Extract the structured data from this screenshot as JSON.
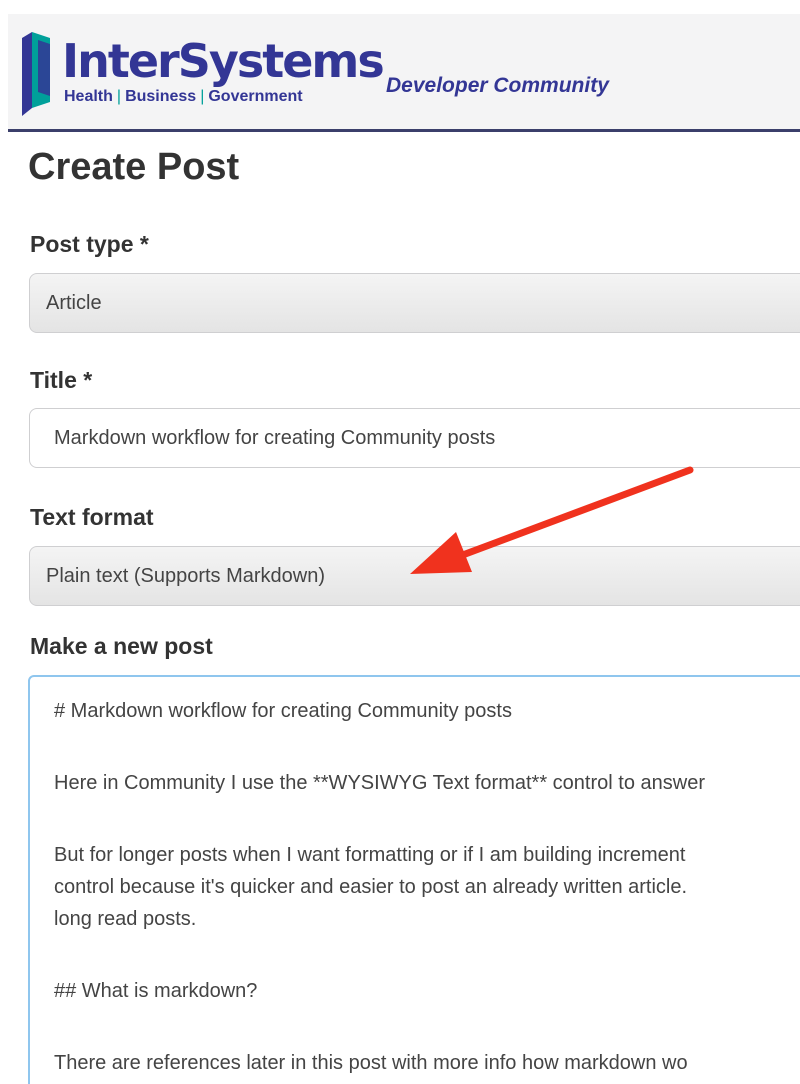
{
  "header": {
    "brand": "InterSystems",
    "tagline": [
      "Health",
      "Business",
      "Government"
    ],
    "tagline_separator": "|",
    "community_label": "Developer Community",
    "colors": {
      "brand": "#333695",
      "accent": "#00a09a"
    }
  },
  "page": {
    "title": "Create Post"
  },
  "form": {
    "post_type": {
      "label": "Post type *",
      "value": "Article"
    },
    "title": {
      "label": "Title *",
      "value": "Markdown workflow for creating Community posts"
    },
    "text_format": {
      "label": "Text format",
      "value": "Plain text (Supports Markdown)"
    },
    "body": {
      "label": "Make a new post",
      "paragraphs": [
        [
          "# Markdown workflow for creating Community posts"
        ],
        [
          "Here in Community I use the **WYSIWYG Text format** control to answer"
        ],
        [
          "But for longer posts when I want formatting or if I am building increment",
          "control because it's quicker and easier to post an already written article.",
          "long read posts."
        ],
        [
          "## What is markdown?"
        ],
        [
          "There are references later in this post with more info how markdown wo"
        ]
      ]
    }
  },
  "annotation": {
    "arrow_color": "#f0321e",
    "arrow_icon": "red-arrow-annotation-icon"
  }
}
